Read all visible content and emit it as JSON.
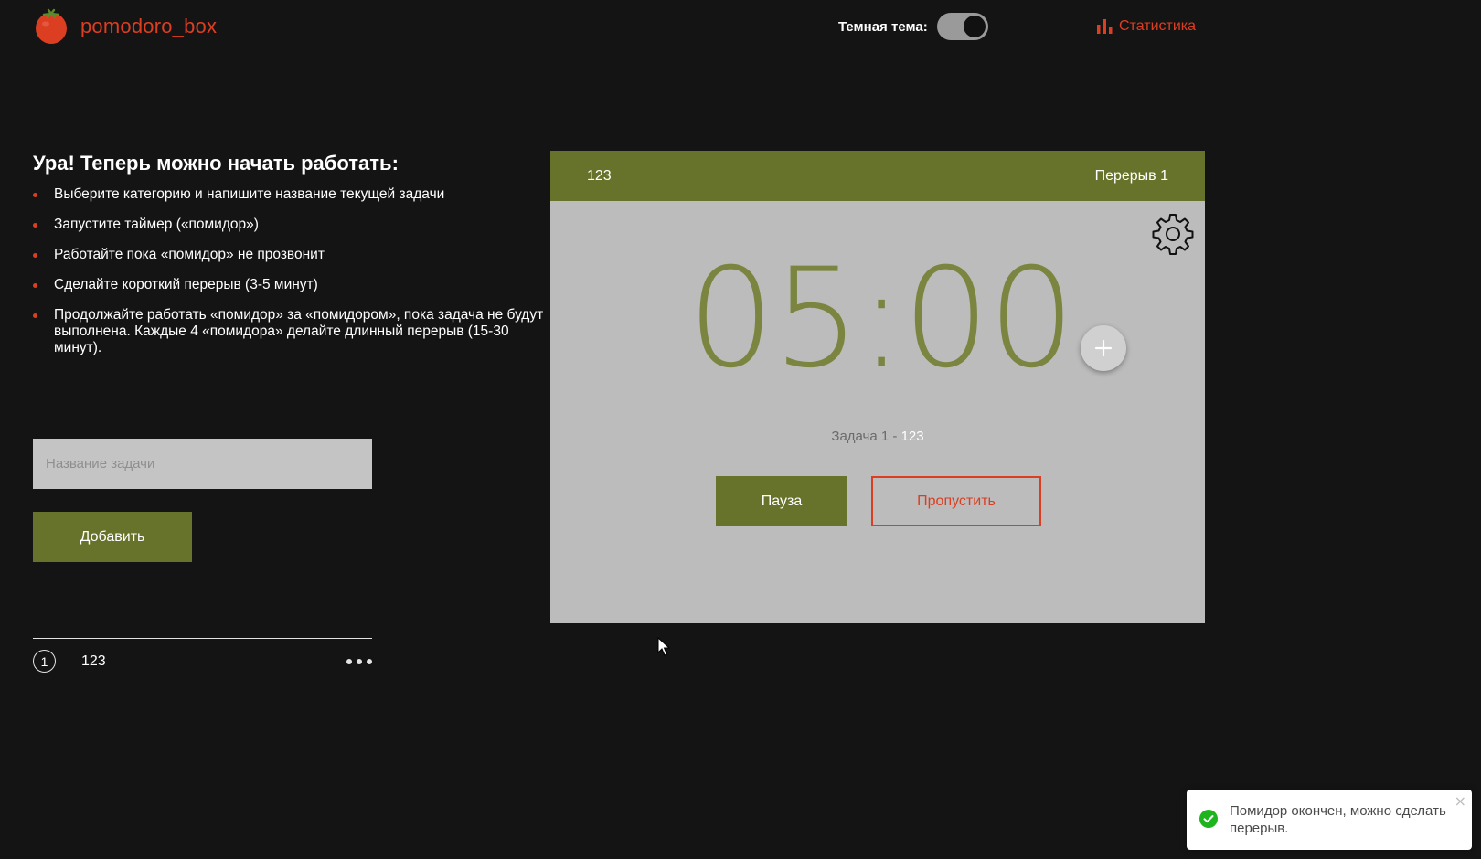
{
  "header": {
    "app_name": "pomodoro_box",
    "theme_label": "Темная тема:",
    "dark_theme_on": true,
    "stats_label": "Статистика"
  },
  "intro": {
    "title": "Ура! Теперь можно начать работать:",
    "steps": [
      "Выберите категорию и напишите название текущей задачи",
      "Запустите таймер («помидор»)",
      "Работайте пока «помидор» не прозвонит",
      "Сделайте короткий перерыв (3-5 минут)",
      "Продолжайте работать «помидор» за «помидором», пока задача не будут выполнена. Каждые 4 «помидора» делайте длинный перерыв (15-30 минут)."
    ]
  },
  "form": {
    "input_placeholder": "Название задачи",
    "input_value": "",
    "add_label": "Добавить"
  },
  "tasks": [
    {
      "count": "1",
      "name": "123"
    }
  ],
  "timer": {
    "task_name": "123",
    "phase": "Перерыв 1",
    "time": "05:00",
    "caption_prefix": "Задача 1 - ",
    "caption_task": "123",
    "pause_label": "Пауза",
    "skip_label": "Пропустить"
  },
  "toast": {
    "message": "Помидор окончен, можно сделать перерыв.",
    "close": "×"
  },
  "colors": {
    "brand_red": "#dc3e22",
    "olive": "#67732b",
    "timer_digits": "#7b8540",
    "card_bg": "#bcbcbc",
    "success": "#1db41d"
  },
  "icons": {
    "logo": "tomato-icon",
    "stats": "bar-chart-icon",
    "settings": "gear-icon",
    "add_minute": "plus-icon",
    "task_menu": "more-dots-icon",
    "toast": "check-circle-icon",
    "close": "close-icon"
  }
}
